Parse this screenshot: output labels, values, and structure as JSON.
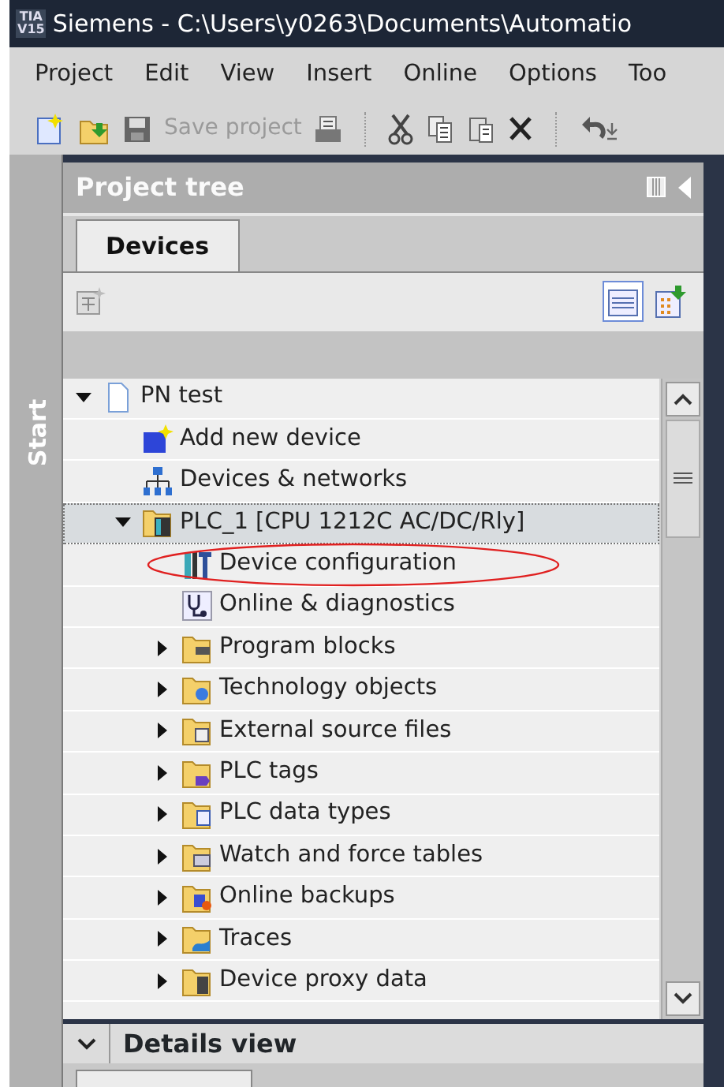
{
  "window": {
    "logo_top": "TIA",
    "logo_bottom": "V15",
    "title": "Siemens  -  C:\\Users\\y0263\\Documents\\Automatio"
  },
  "menu": [
    "Project",
    "Edit",
    "View",
    "Insert",
    "Online",
    "Options",
    "Too"
  ],
  "toolbar": {
    "save_label": "Save project",
    "save_disabled": true
  },
  "side_strip": {
    "label": "Start"
  },
  "project_tree": {
    "title": "Project tree",
    "tabs": [
      {
        "label": "Devices",
        "selected": true
      }
    ],
    "view_buttons": [
      {
        "selected": true
      },
      {
        "selected": false
      }
    ],
    "items": [
      {
        "label": "PN test",
        "kind": "project",
        "expanded": true,
        "selected": false,
        "circled": false,
        "children": [
          {
            "label": "Add new device",
            "kind": "add",
            "selected": false,
            "circled": false
          },
          {
            "label": "Devices & networks",
            "kind": "network",
            "selected": false,
            "circled": false
          },
          {
            "label": "PLC_1 [CPU 1212C AC/DC/Rly]",
            "kind": "plc",
            "expanded": true,
            "selected": true,
            "circled": false,
            "children": [
              {
                "label": "Device configuration",
                "kind": "config",
                "selected": false,
                "circled": true
              },
              {
                "label": "Online & diagnostics",
                "kind": "diagnostics",
                "selected": false,
                "circled": false
              },
              {
                "label": "Program blocks",
                "kind": "folder",
                "expanded": false,
                "selected": false,
                "circled": false
              },
              {
                "label": "Technology objects",
                "kind": "folder",
                "expanded": false,
                "selected": false,
                "circled": false
              },
              {
                "label": "External source files",
                "kind": "folder",
                "expanded": false,
                "selected": false,
                "circled": false
              },
              {
                "label": "PLC tags",
                "kind": "folder",
                "expanded": false,
                "selected": false,
                "circled": false
              },
              {
                "label": "PLC data types",
                "kind": "folder",
                "expanded": false,
                "selected": false,
                "circled": false
              },
              {
                "label": "Watch and force tables",
                "kind": "folder",
                "expanded": false,
                "selected": false,
                "circled": false
              },
              {
                "label": "Online backups",
                "kind": "folder",
                "expanded": false,
                "selected": false,
                "circled": false
              },
              {
                "label": "Traces",
                "kind": "folder",
                "expanded": false,
                "selected": false,
                "circled": false
              },
              {
                "label": "Device proxy data",
                "kind": "folder",
                "expanded": false,
                "selected": false,
                "circled": false
              }
            ]
          }
        ]
      }
    ]
  },
  "details_view": {
    "title": "Details view",
    "expanded": true
  }
}
